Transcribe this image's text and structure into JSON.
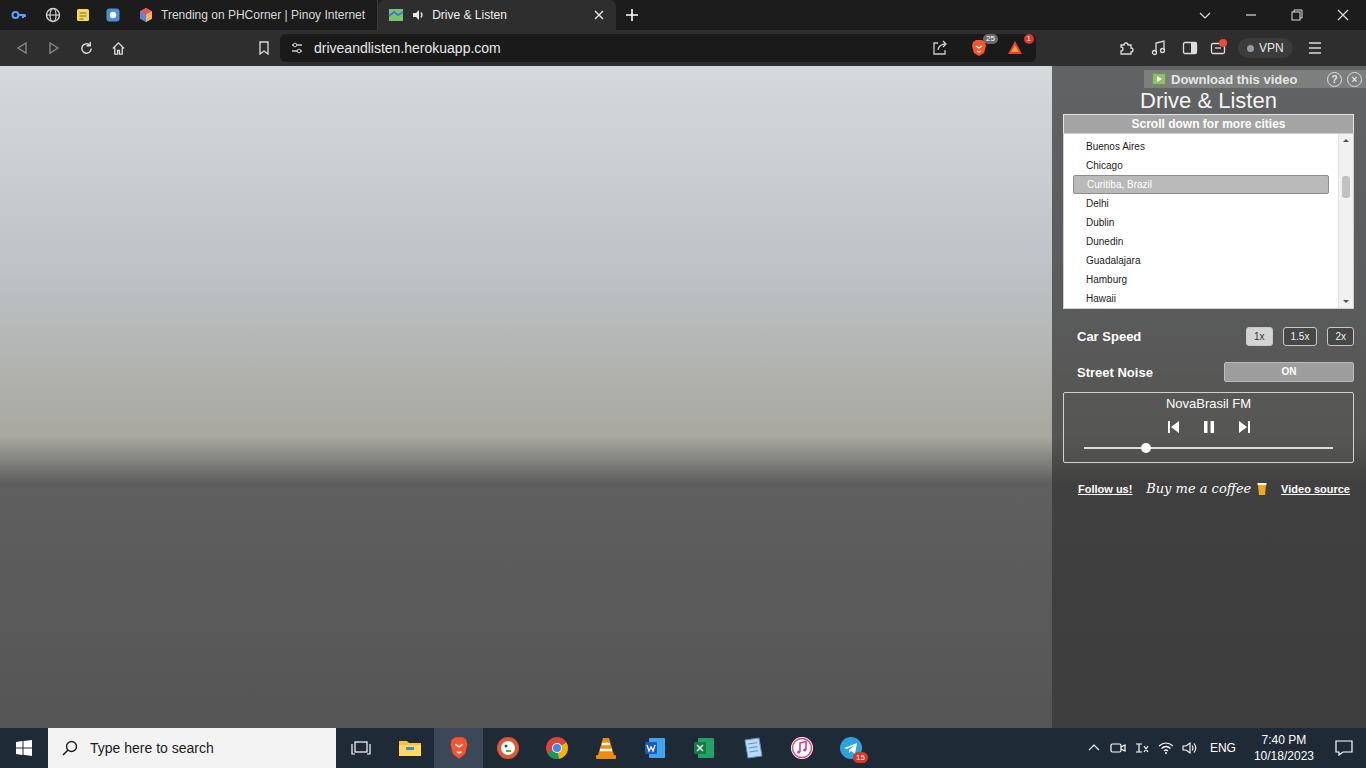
{
  "browser": {
    "pinned_tabs": [
      {
        "kind": "key"
      },
      {
        "kind": "globe"
      },
      {
        "kind": "notes"
      },
      {
        "kind": "app"
      }
    ],
    "tabs": [
      {
        "label": "Trending on PHCorner | Pinoy Internet",
        "selected": false,
        "kind": "cube",
        "audio": false
      },
      {
        "label": "Drive & Listen",
        "selected": true,
        "kind": "map",
        "audio": true
      }
    ],
    "address": "driveandlisten.herokuapp.com",
    "shields_count": "25",
    "alerts_count": "1",
    "wallet_notice": true,
    "vpn": "VPN"
  },
  "overlay": {
    "label": "Download this video",
    "help": "?",
    "close": "×"
  },
  "player": {
    "title": "Drive & Listen",
    "list_header": "Scroll down for more cities",
    "scroll_level": 0.2,
    "cities": [
      {
        "label": "Buenos Aires",
        "selected": false
      },
      {
        "label": "Chicago",
        "selected": false
      },
      {
        "label": "Curitiba, Brazil",
        "selected": true
      },
      {
        "label": "Delhi",
        "selected": false
      },
      {
        "label": "Dublin",
        "selected": false
      },
      {
        "label": "Dunedin",
        "selected": false
      },
      {
        "label": "Guadalajara",
        "selected": false
      },
      {
        "label": "Hamburg",
        "selected": false
      },
      {
        "label": "Hawaii",
        "selected": false
      }
    ],
    "speed_label": "Car Speed",
    "speeds": [
      {
        "label": "1x",
        "selected": true
      },
      {
        "label": "1.5x",
        "selected": false
      },
      {
        "label": "2x",
        "selected": false
      }
    ],
    "noise_label": "Street Noise",
    "noise": {
      "label": "ON",
      "on": true
    },
    "radio": {
      "station": "NovaBrasil FM",
      "playing": true,
      "level": 0.25
    },
    "links": {
      "follow": "Follow us!",
      "coffee": "Buy me a coffee",
      "source": "Video source"
    }
  },
  "taskbar": {
    "search_placeholder": "Type here to search",
    "apps": [
      {
        "kind": "explorer",
        "active": false,
        "badge": ""
      },
      {
        "kind": "brave",
        "active": true,
        "badge": ""
      },
      {
        "kind": "duckduckgo",
        "active": false,
        "badge": ""
      },
      {
        "kind": "chrome",
        "active": false,
        "badge": ""
      },
      {
        "kind": "vlc",
        "active": false,
        "badge": ""
      },
      {
        "kind": "word",
        "active": false,
        "badge": ""
      },
      {
        "kind": "excel",
        "active": false,
        "badge": ""
      },
      {
        "kind": "notepad",
        "active": false,
        "badge": ""
      },
      {
        "kind": "itunes",
        "active": false,
        "badge": ""
      },
      {
        "kind": "telegram",
        "active": false,
        "badge": "15"
      }
    ],
    "tray": [
      {
        "kind": "chevron"
      },
      {
        "kind": "meet"
      },
      {
        "kind": "ime"
      },
      {
        "kind": "wifi"
      },
      {
        "kind": "volume"
      }
    ],
    "language": "ENG",
    "time": "7:40 PM",
    "date": "10/18/2023"
  }
}
